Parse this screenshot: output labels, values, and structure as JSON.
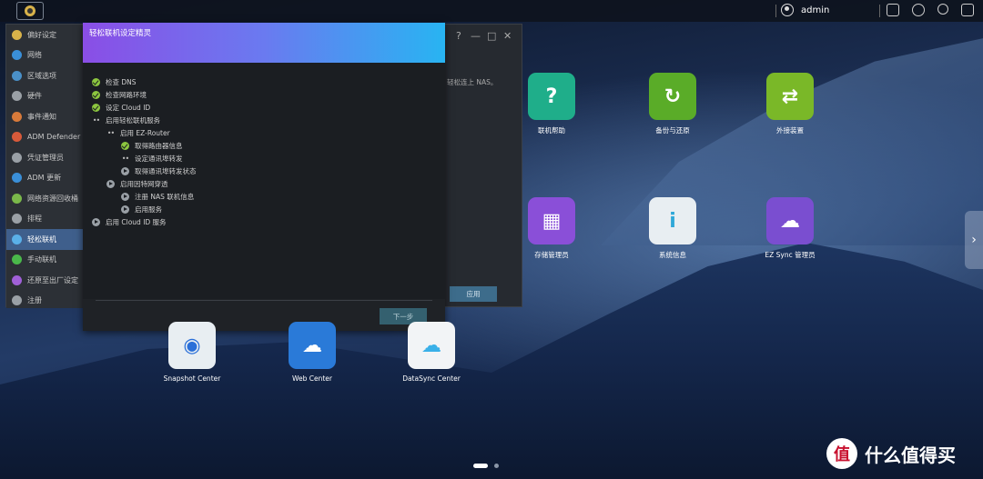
{
  "topbar": {
    "user": "admin"
  },
  "settings": {
    "sidebar": [
      {
        "label": "偏好设定",
        "color": "#d8b24a"
      },
      {
        "label": "网络",
        "color": "#3a8fd8"
      },
      {
        "label": "区域选项",
        "color": "#4a90c8"
      },
      {
        "label": "硬件",
        "color": "#9aa0a6"
      },
      {
        "label": "事件通知",
        "color": "#d87a3a"
      },
      {
        "label": "ADM Defender",
        "color": "#d85a3a"
      },
      {
        "label": "凭证管理员",
        "color": "#9aa0a6"
      },
      {
        "label": "ADM 更新",
        "color": "#3a8fd8"
      },
      {
        "label": "网络资源回收桶",
        "color": "#7ab84a"
      },
      {
        "label": "排程",
        "color": "#9aa0a6"
      },
      {
        "label": "轻松联机",
        "color": "#5ab0e8",
        "active": true
      },
      {
        "label": "手动联机",
        "color": "#4ab84a"
      },
      {
        "label": "还原至出厂设定",
        "color": "#a060d8"
      },
      {
        "label": "注册",
        "color": "#9aa0a6"
      }
    ],
    "right_text": "轻松连上 NAS。",
    "apply_label": "应用"
  },
  "wizard": {
    "title": "轻松联机设定精灵",
    "steps": [
      {
        "label": "检查 DNS",
        "status": "ok"
      },
      {
        "label": "检查网路环境",
        "status": "ok"
      },
      {
        "label": "设定 Cloud ID",
        "status": "ok"
      },
      {
        "label": "启用轻松联机服务",
        "status": "running"
      },
      {
        "label": "启用 EZ-Router",
        "status": "running"
      },
      {
        "label": "取得路由器信息",
        "status": "ok"
      },
      {
        "label": "设定通讯埠转发",
        "status": "running"
      },
      {
        "label": "取得通讯埠转发状态",
        "status": "pending"
      },
      {
        "label": "启用因特网穿透",
        "status": "pending"
      },
      {
        "label": "注册 NAS 联机信息",
        "status": "pending"
      },
      {
        "label": "启用服务",
        "status": "pending"
      },
      {
        "label": "启用 Cloud ID 服务",
        "status": "pending"
      }
    ],
    "next_label": "下一步"
  },
  "desktop": {
    "apps": [
      {
        "label": "联机帮助",
        "color": "#1fae8a"
      },
      {
        "label": "备份与还原",
        "color": "#5aac28"
      },
      {
        "label": "外接装置",
        "color": "#7ab828"
      },
      {
        "label": "存储管理员",
        "color": "#8a4fd8"
      },
      {
        "label": "系统信息",
        "color": "#e8eef2"
      },
      {
        "label": "EZ Sync 管理员",
        "color": "#7a4ed0"
      },
      {
        "label": "Snapshot Center",
        "color": "#e8eef2"
      },
      {
        "label": "Web Center",
        "color": "#2a7ad8"
      },
      {
        "label": "DataSync Center",
        "color": "#f2f4f6"
      }
    ]
  },
  "watermark": "什么值得买"
}
